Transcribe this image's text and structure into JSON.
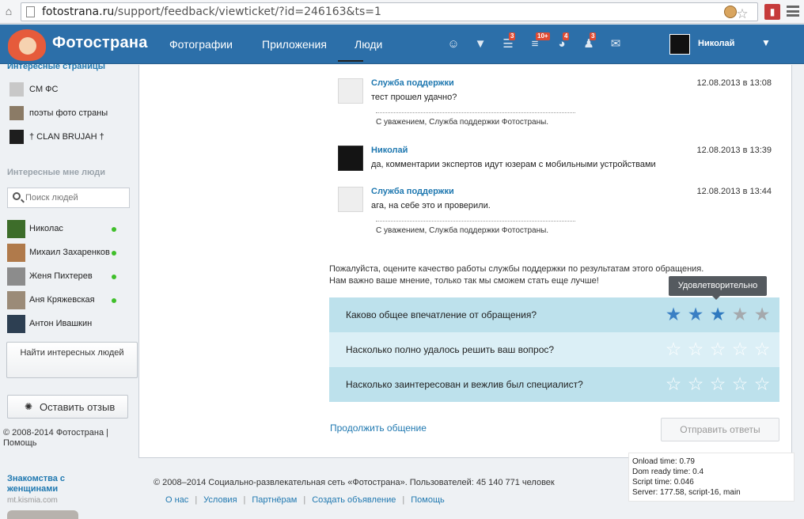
{
  "browser": {
    "url_host": "fotostrana.ru",
    "url_path": "/support/feedback/viewticket/?id=246163&ts=1"
  },
  "topnav": {
    "logo": "Фотострана",
    "links": [
      "Фотографии",
      "Приложения",
      "Люди"
    ],
    "badges": {
      "notes": "3",
      "feed": "10+",
      "games": "4",
      "friends": "3"
    },
    "user": "Николай"
  },
  "sidebar": {
    "pages_title": "Интересные страницы",
    "pages": [
      "CM ФС",
      "поэты фото страны",
      "† CLAN BRUJAH †"
    ],
    "people_title": "Интересные мне люди",
    "search_placeholder": "Поиск людей",
    "people": [
      {
        "name": "Николас",
        "online": true
      },
      {
        "name": "Михаил Захаренков",
        "online": true
      },
      {
        "name": "Женя Пихтерев",
        "online": true
      },
      {
        "name": "Аня Кряжевская",
        "online": true
      },
      {
        "name": "Антон Ивашкин",
        "online": false
      }
    ],
    "find_people": "Найти интересных людей",
    "leave_feedback": "Оставить отзыв",
    "copyright": "© 2008-2014 Фотострана",
    "help": "Помощь",
    "ad_title": "Знакомства с женщинами",
    "ad_url": "mt.kismia.com"
  },
  "messages": [
    {
      "author": "Служба поддержки",
      "time": "12.08.2013 в 13:08",
      "text": "тест прошел удачно?",
      "signature": "С уважением, Служба поддержки Фотостраны."
    },
    {
      "author": "Николай",
      "time": "12.08.2013 в 13:39",
      "text": "да, комментарии экспертов идут юзерам с мобильными устройствами",
      "signature": ""
    },
    {
      "author": "Служба поддержки",
      "time": "12.08.2013 в 13:44",
      "text": "ага, на себе это и проверили.",
      "signature": "С уважением, Служба поддержки Фотостраны."
    }
  ],
  "rating": {
    "intro_line1": "Пожалуйста, оцените качество работы службы поддержки по результатам этого обращения.",
    "intro_line2": "Нам важно ваше мнение, только так мы сможем стать еще лучше!",
    "tooltip": "Удовлетворительно",
    "questions": [
      {
        "text": "Каково общее впечатление от обращения?",
        "value": 3
      },
      {
        "text": "Насколько полно удалось решить ваш вопрос?",
        "value": 0
      },
      {
        "text": "Насколько заинтересован и вежлив был специалист?",
        "value": 0
      }
    ],
    "max": 5,
    "continue_link": "Продолжить общение",
    "submit": "Отправить ответы"
  },
  "footer": {
    "copyright": "© 2008–2014 Социально-развлекательная сеть «Фотострана». Пользователей: 45 140 771 человек",
    "links": [
      "О нас",
      "Условия",
      "Партнёрам",
      "Создать объявление",
      "Помощь"
    ]
  },
  "debug": {
    "onload": "Onload time: 0.79",
    "domready": "Dom ready time: 0.4",
    "script": "Script time: 0.046",
    "server": "Server: 177.58, script-16, main"
  },
  "colors": {
    "accent": "#2c6fa9",
    "star_on": "#3a7fc4",
    "star_hover": "#2f79bf",
    "star_off": "#a5a9ad",
    "row_dark": "#bde1ec",
    "row_light": "#dbeff6"
  }
}
